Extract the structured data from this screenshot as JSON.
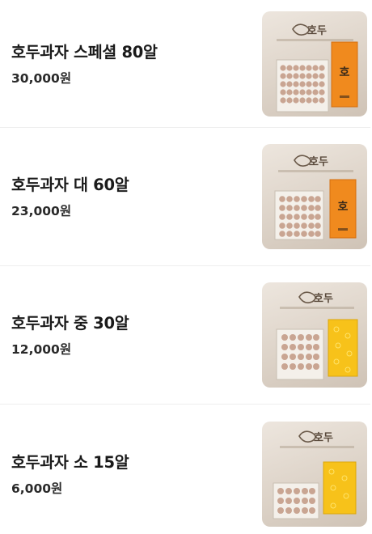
{
  "products": [
    {
      "name": "호두과자 스페셜 80알",
      "price": "30,000원",
      "image_icon": "walnut-cake-orange-box-image",
      "box_color": "#f08a1e"
    },
    {
      "name": "호두과자 대 60알",
      "price": "23,000원",
      "image_icon": "walnut-cake-orange-box-image",
      "box_color": "#f08a1e"
    },
    {
      "name": "호두과자 중 30알",
      "price": "12,000원",
      "image_icon": "walnut-cake-yellow-box-image",
      "box_color": "#f7c21a"
    },
    {
      "name": "호두과자 소 15알",
      "price": "6,000원",
      "image_icon": "walnut-cake-yellow-box-image",
      "box_color": "#f7c21a"
    }
  ]
}
